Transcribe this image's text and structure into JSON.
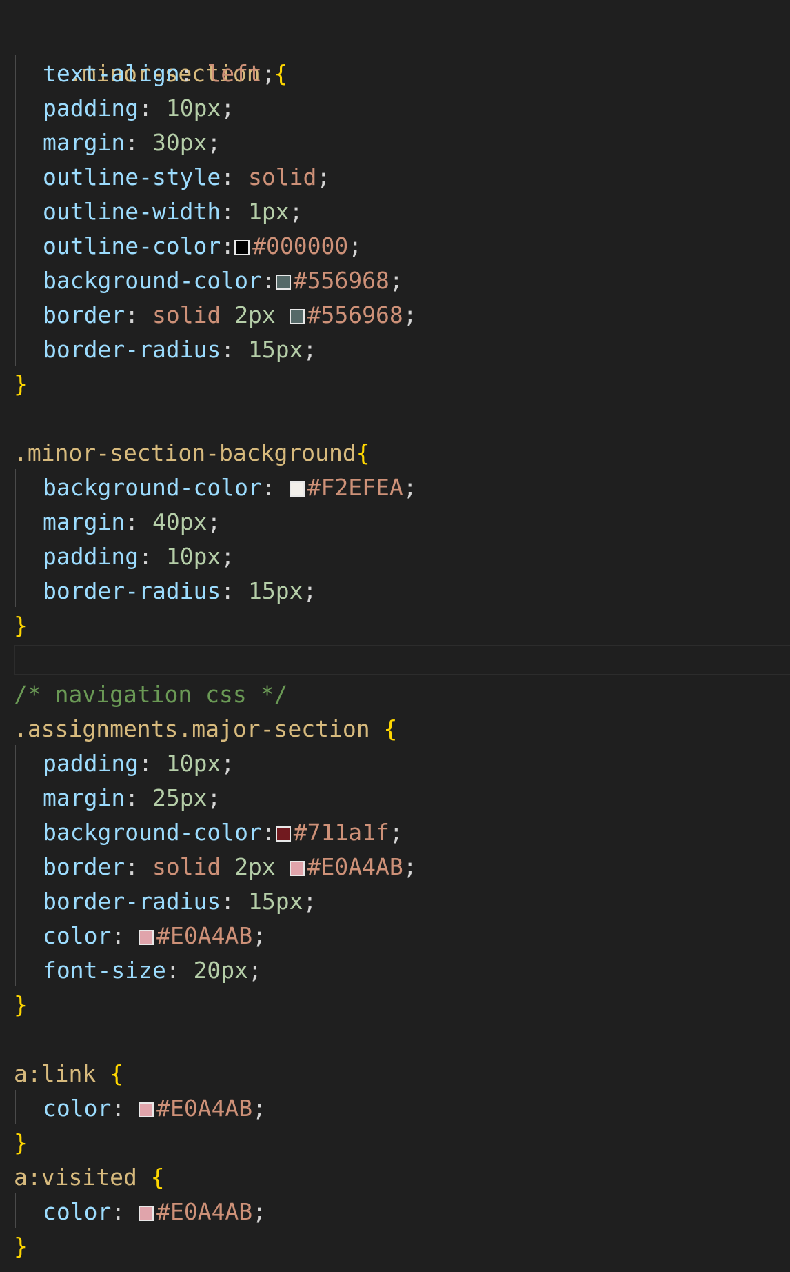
{
  "editor": {
    "language": "css",
    "colors": {
      "background": "#1f1f1f",
      "selector": "#d7ba7d",
      "property": "#9cdcfe",
      "number": "#b5cea8",
      "string": "#ce9178",
      "comment": "#6a9955",
      "brace": "#ffd700"
    },
    "rules": [
      {
        "selector": ".minor-section",
        "open": "{",
        "close": "}",
        "declarations": [
          {
            "property": "text-align",
            "value": "left"
          },
          {
            "property": "padding",
            "value": "10px"
          },
          {
            "property": "margin",
            "value": "30px"
          },
          {
            "property": "outline-style",
            "value": "solid"
          },
          {
            "property": "outline-width",
            "value": "1px"
          },
          {
            "property": "outline-color",
            "value": "#000000",
            "swatch": "#000000"
          },
          {
            "property": "background-color",
            "value": "#556968",
            "swatch": "#556968"
          },
          {
            "property": "border",
            "value_prefix": "solid",
            "value_size": "2px",
            "value": "#556968",
            "swatch": "#556968"
          },
          {
            "property": "border-radius",
            "value": "15px"
          }
        ]
      },
      {
        "selector": ".minor-section-background",
        "open": "{",
        "close": "}",
        "declarations": [
          {
            "property": "background-color",
            "value": "#F2EFEA",
            "swatch": "#F2EFEA"
          },
          {
            "property": "margin",
            "value": "40px"
          },
          {
            "property": "padding",
            "value": "10px"
          },
          {
            "property": "border-radius",
            "value": "15px"
          }
        ]
      },
      {
        "comment": "/* navigation css */",
        "selector": ".assignments.major-section",
        "open": "{",
        "close": "}",
        "declarations": [
          {
            "property": "padding",
            "value": "10px"
          },
          {
            "property": "margin",
            "value": "25px"
          },
          {
            "property": "background-color",
            "value": "#711a1f",
            "swatch": "#711a1f"
          },
          {
            "property": "border",
            "value_prefix": "solid",
            "value_size": "2px",
            "value": "#E0A4AB",
            "swatch": "#E0A4AB"
          },
          {
            "property": "border-radius",
            "value": "15px"
          },
          {
            "property": "color",
            "value": "#E0A4AB",
            "swatch": "#E0A4AB"
          },
          {
            "property": "font-size",
            "value": "20px"
          }
        ]
      },
      {
        "selector": "a:link",
        "open": "{",
        "close": "}",
        "declarations": [
          {
            "property": "color",
            "value": "#E0A4AB",
            "swatch": "#E0A4AB"
          }
        ]
      },
      {
        "selector": "a:visited",
        "open": "{",
        "close": "}",
        "declarations": [
          {
            "property": "color",
            "value": "#E0A4AB",
            "swatch": "#E0A4AB"
          }
        ]
      }
    ]
  }
}
